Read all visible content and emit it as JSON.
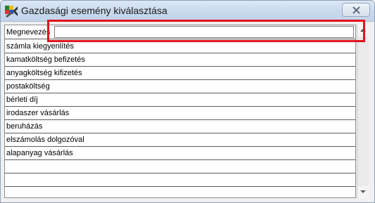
{
  "window": {
    "title": "Gazdasági esemény kiválasztása"
  },
  "filter": {
    "label": "Megnevezés",
    "value": ""
  },
  "list": {
    "items": [
      "számla kiegyenlítés",
      "kamatköltség befizetés",
      "anyagköltség kifizetés",
      "postaköltség",
      "bérleti díj",
      "irodaszer vásárlás",
      "beruházás",
      "elszámolás dolgozóval",
      "alapanyag vásárlás",
      "",
      "",
      ""
    ]
  },
  "colors": {
    "highlight": "#e0141d",
    "titlebar": "#c8d9ed"
  },
  "icons": {
    "app": "puzzle-icon",
    "close": "close-icon",
    "scroll_up": "arrow-up-icon",
    "scroll_down": "arrow-down-icon"
  }
}
